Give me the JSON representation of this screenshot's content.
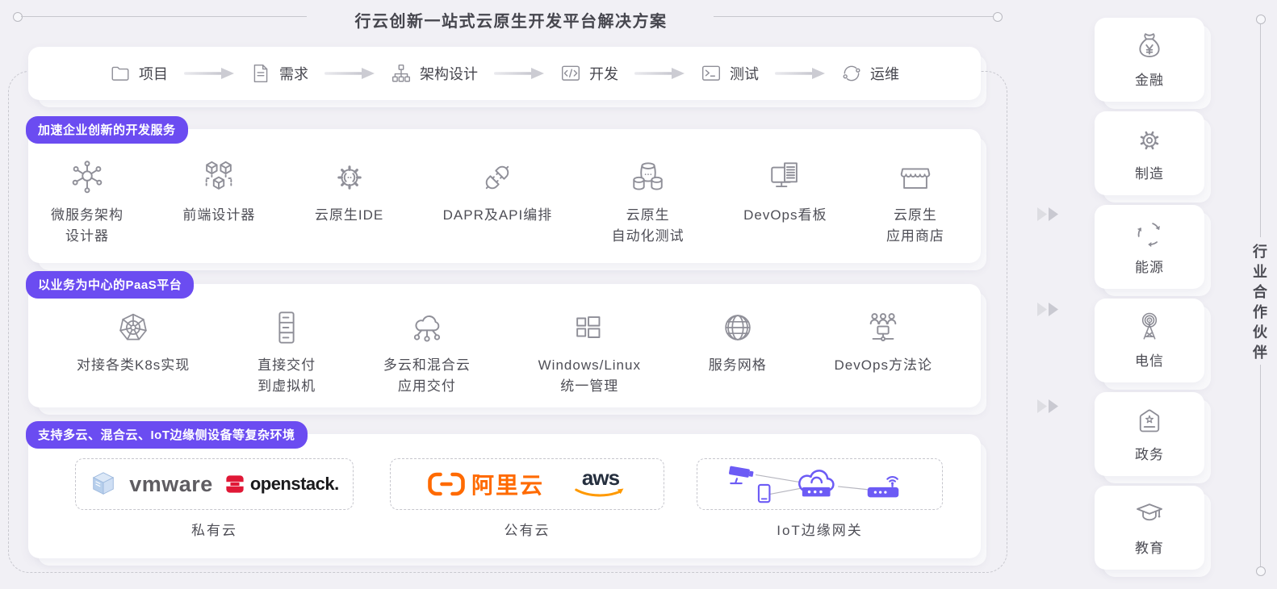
{
  "title": "行云创新一站式云原生开发平台解决方案",
  "workflow": {
    "steps": [
      {
        "label": "项目"
      },
      {
        "label": "需求"
      },
      {
        "label": "架构设计"
      },
      {
        "label": "开发"
      },
      {
        "label": "测试"
      },
      {
        "label": "运维"
      }
    ]
  },
  "sections": [
    {
      "badge": "加速企业创新的开发服务",
      "items": [
        {
          "label": "微服务架构\n设计器"
        },
        {
          "label": "前端设计器"
        },
        {
          "label": "云原生IDE"
        },
        {
          "label": "DAPR及API编排"
        },
        {
          "label": "云原生\n自动化测试"
        },
        {
          "label": "DevOps看板"
        },
        {
          "label": "云原生\n应用商店"
        }
      ]
    },
    {
      "badge": "以业务为中心的PaaS平台",
      "items": [
        {
          "label": "对接各类K8s实现"
        },
        {
          "label": "直接交付\n到虚拟机"
        },
        {
          "label": "多云和混合云\n应用交付"
        },
        {
          "label": "Windows/Linux\n统一管理"
        },
        {
          "label": "服务网格"
        },
        {
          "label": "DevOps方法论"
        }
      ]
    },
    {
      "badge": "支持多云、混合云、IoT边缘侧设备等复杂环境",
      "groups": [
        {
          "label": "私有云"
        },
        {
          "label": "公有云"
        },
        {
          "label": "IoT边缘网关"
        }
      ]
    }
  ],
  "logos": {
    "vmware": "vmware",
    "openstack": "openstack.",
    "alibaba_cloud": "阿里云",
    "aws": "aws"
  },
  "partners": {
    "title": "行业合作伙伴",
    "industries": [
      {
        "label": "金融"
      },
      {
        "label": "制造"
      },
      {
        "label": "能源"
      },
      {
        "label": "电信"
      },
      {
        "label": "政务"
      },
      {
        "label": "教育"
      }
    ]
  },
  "colors": {
    "badge_purple": "#6B4CF1",
    "iot_purple": "#6C5BF5",
    "alibaba_orange": "#FF6A00",
    "aws_text": "#252F3E",
    "aws_smile": "#FF9900",
    "openstack_red": "#E01836",
    "icon_gray": "#8F8F98"
  }
}
